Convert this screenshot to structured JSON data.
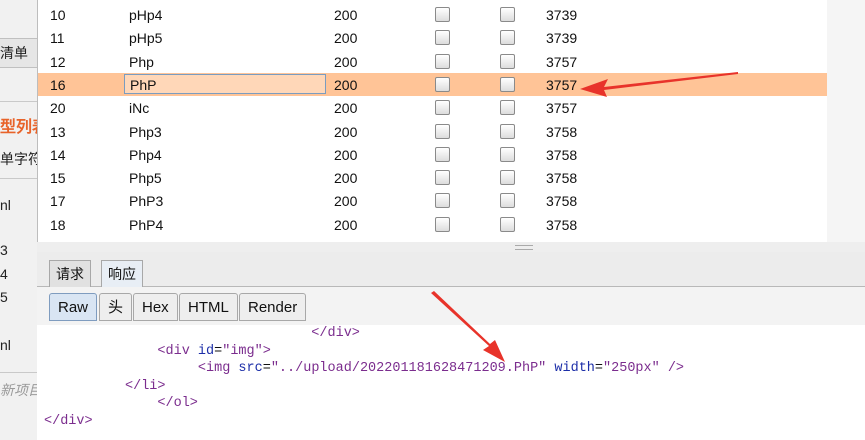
{
  "left_panel": {
    "items": [
      {
        "text": "清单",
        "style": "normal"
      },
      {
        "text": "型列表",
        "style": "orange"
      },
      {
        "text": "单字符",
        "style": "normal"
      },
      {
        "text": "nl",
        "style": "normal"
      },
      {
        "text": "3",
        "style": "normal"
      },
      {
        "text": "4",
        "style": "normal"
      },
      {
        "text": "5",
        "style": "normal"
      },
      {
        "text": "nl",
        "style": "normal"
      },
      {
        "text": "新项目",
        "style": "italic"
      }
    ]
  },
  "results_table": {
    "rows": [
      {
        "id": "10",
        "payload": "pHp4",
        "status": "200",
        "length": "3739",
        "selected": false
      },
      {
        "id": "11",
        "payload": "pHp5",
        "status": "200",
        "length": "3739",
        "selected": false
      },
      {
        "id": "12",
        "payload": "Php",
        "status": "200",
        "length": "3757",
        "selected": false
      },
      {
        "id": "16",
        "payload": "PhP",
        "status": "200",
        "length": "3757",
        "selected": true
      },
      {
        "id": "20",
        "payload": "iNc",
        "status": "200",
        "length": "3757",
        "selected": false
      },
      {
        "id": "13",
        "payload": "Php3",
        "status": "200",
        "length": "3758",
        "selected": false
      },
      {
        "id": "14",
        "payload": "Php4",
        "status": "200",
        "length": "3758",
        "selected": false
      },
      {
        "id": "15",
        "payload": "Php5",
        "status": "200",
        "length": "3758",
        "selected": false
      },
      {
        "id": "17",
        "payload": "PhP3",
        "status": "200",
        "length": "3758",
        "selected": false
      },
      {
        "id": "18",
        "payload": "PhP4",
        "status": "200",
        "length": "3758",
        "selected": false
      }
    ]
  },
  "message_tabs": {
    "items": [
      {
        "label": "请求",
        "active": false
      },
      {
        "label": "响应",
        "active": true
      }
    ]
  },
  "view_tabs": {
    "items": [
      {
        "label": "Raw",
        "active": true
      },
      {
        "label": "头",
        "active": false
      },
      {
        "label": "Hex",
        "active": false
      },
      {
        "label": "HTML",
        "active": false
      },
      {
        "label": "Render",
        "active": false
      }
    ]
  },
  "response_body": {
    "lines": [
      {
        "indent": 33,
        "parts": [
          {
            "t": "</div>",
            "c": "tag"
          }
        ]
      },
      {
        "indent": 14,
        "parts": [
          {
            "t": "<div ",
            "c": "tag"
          },
          {
            "t": "id",
            "c": "attr"
          },
          {
            "t": "=",
            "c": "plain"
          },
          {
            "t": "\"img\"",
            "c": "val"
          },
          {
            "t": ">",
            "c": "tag"
          }
        ]
      },
      {
        "indent": 19,
        "parts": [
          {
            "t": "<img ",
            "c": "tag"
          },
          {
            "t": "src",
            "c": "attr"
          },
          {
            "t": "=",
            "c": "plain"
          },
          {
            "t": "\"../upload/202201181628471209.PhP\"",
            "c": "val"
          },
          {
            "t": " ",
            "c": "plain"
          },
          {
            "t": "width",
            "c": "attr"
          },
          {
            "t": "=",
            "c": "plain"
          },
          {
            "t": "\"250px\"",
            "c": "val"
          },
          {
            "t": " />",
            "c": "tag"
          }
        ]
      },
      {
        "indent": 10,
        "parts": [
          {
            "t": "</li>",
            "c": "tag"
          }
        ]
      },
      {
        "indent": 14,
        "parts": [
          {
            "t": "</ol>",
            "c": "tag"
          }
        ]
      },
      {
        "indent": 0,
        "parts": [
          {
            "t": "</div>",
            "c": "tag"
          }
        ]
      }
    ]
  },
  "annotations": {
    "arrow_color": "#e8332a"
  },
  "colors": {
    "selected_row": "#ffc497",
    "accent_orange": "#e8632a"
  }
}
